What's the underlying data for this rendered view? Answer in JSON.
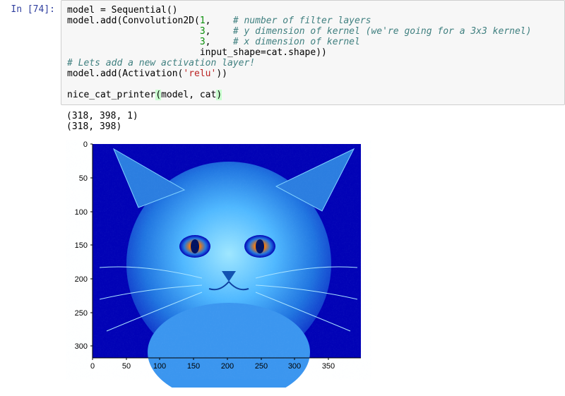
{
  "cell": {
    "prompt": "In [74]:",
    "code": {
      "l1": "model = Sequential()",
      "l2a": "model.add(Convolution2D(",
      "l2_num": "1",
      "l2_sep": ",    ",
      "l2_com": "# number of filter layers",
      "l3_pad": "                        ",
      "l3_num": "3",
      "l3_sep": ",    ",
      "l3_com": "# y dimension of kernel (we're going for a 3x3 kernel)",
      "l4_pad": "                        ",
      "l4_num": "3",
      "l4_sep": ",    ",
      "l4_com": "# x dimension of kernel",
      "l5_pad": "                        ",
      "l5": "input_shape=cat.shape))",
      "l6_com": "# Lets add a new activation layer!",
      "l7a": "model.add(Activation(",
      "l7_str": "'relu'",
      "l7b": "))",
      "l9a": "nice_cat_printer",
      "l9_po": "(",
      "l9b": "model, cat",
      "l9_pc": ")"
    }
  },
  "output": {
    "line1": "(318, 398, 1)",
    "line2": "(318, 398)"
  },
  "chart_data": {
    "type": "heatmap",
    "title": "",
    "xlabel": "",
    "ylabel": "",
    "x_ticks": [
      0,
      50,
      100,
      150,
      200,
      250,
      300,
      350
    ],
    "y_ticks": [
      0,
      50,
      100,
      150,
      200,
      250,
      300
    ],
    "xlim": [
      0,
      398
    ],
    "ylim": [
      318,
      0
    ],
    "image_shape": [
      318,
      398
    ],
    "colormap": "jet",
    "value_range_estimate": [
      0,
      1
    ],
    "description": "ReLU-activated single-channel Conv2D feature map of a cat image shown with jet colormap"
  }
}
